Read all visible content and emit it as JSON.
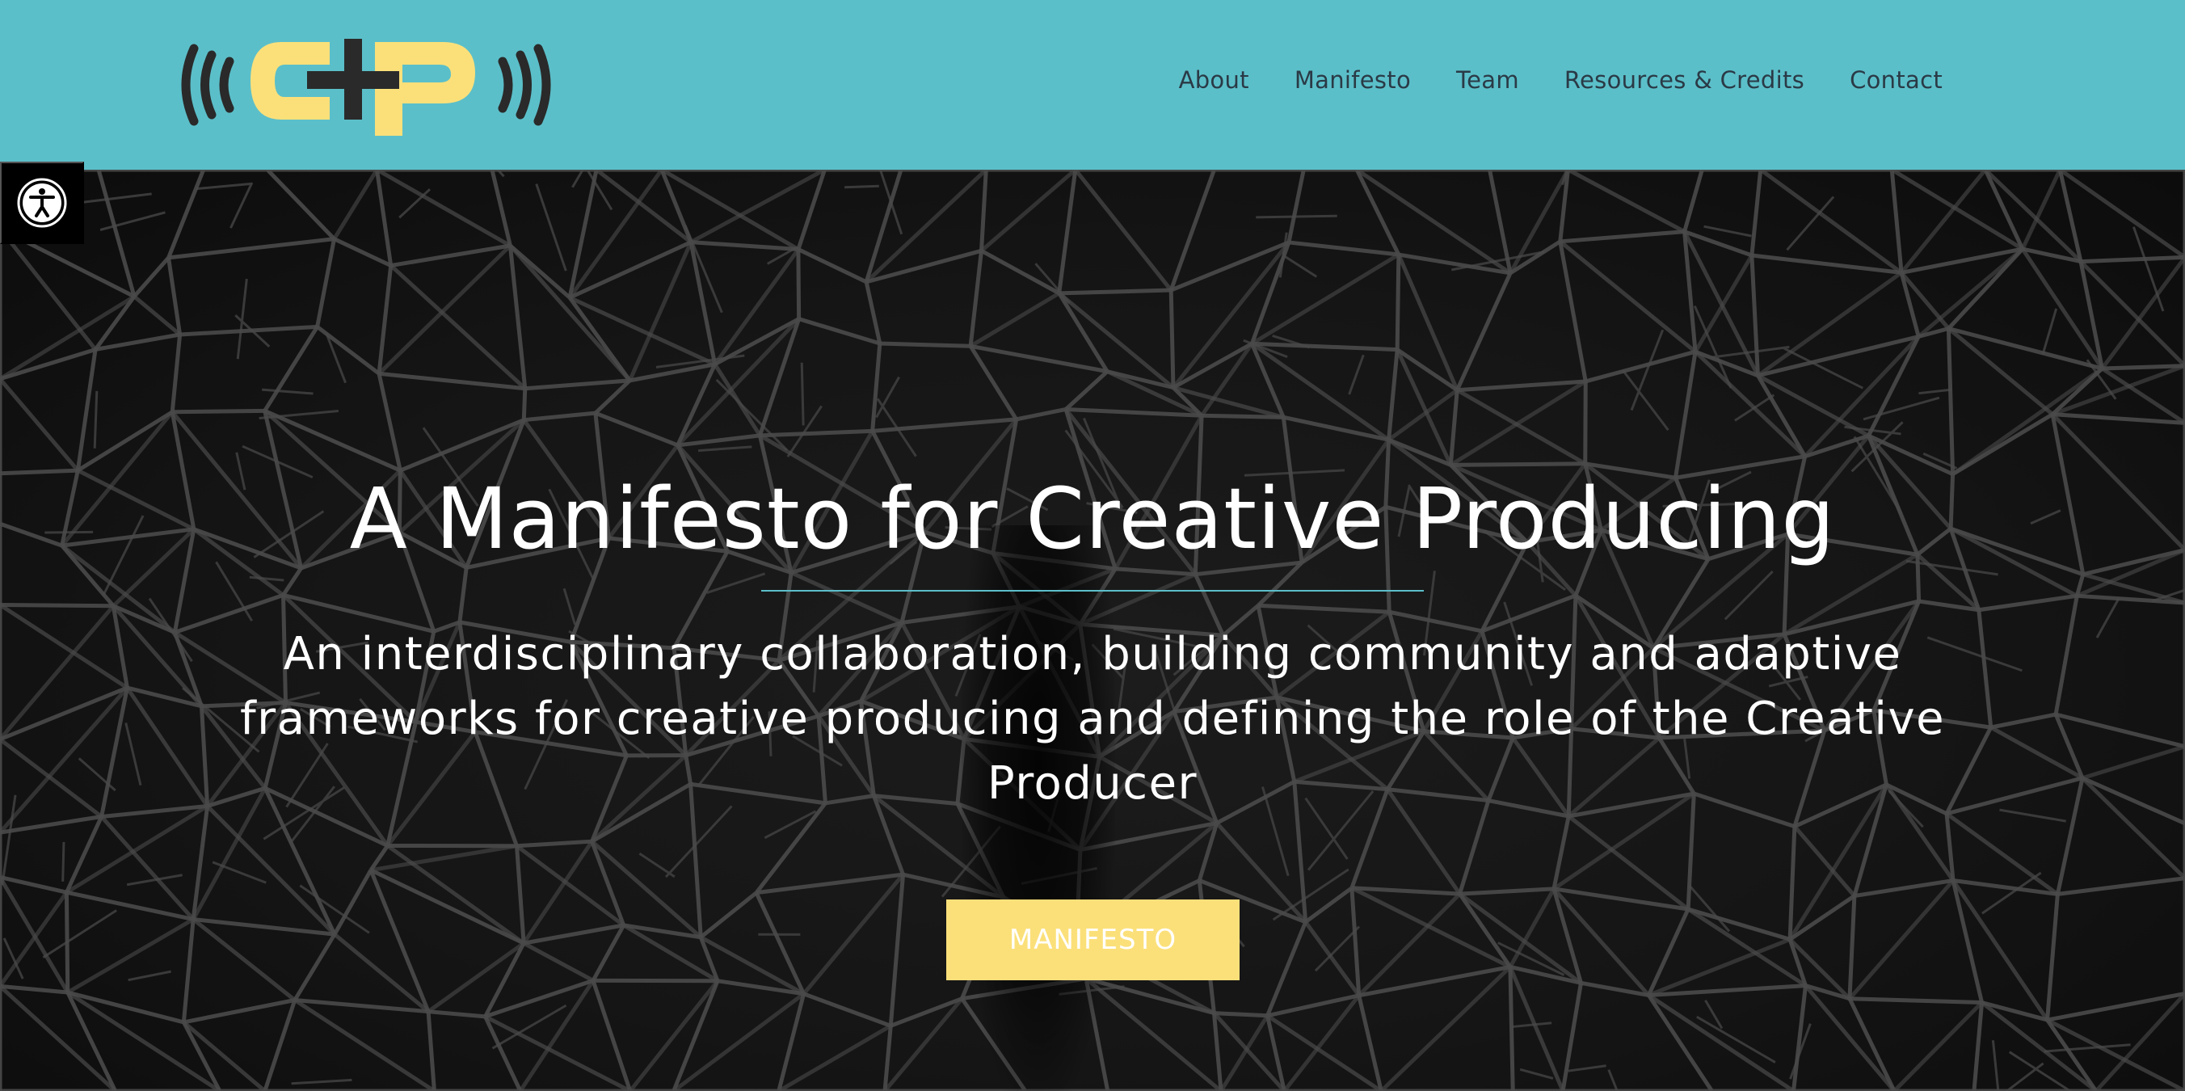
{
  "colors": {
    "header_bg": "#5bbfc9",
    "logo_yellow": "#fbe07a",
    "logo_dark": "#2a2a2a",
    "cta_bg": "#fbe07a",
    "divider": "#5bbfc9"
  },
  "header": {
    "logo_icon": "creative-producing-logo-icon",
    "nav": [
      {
        "label": "About"
      },
      {
        "label": "Manifesto"
      },
      {
        "label": "Team"
      },
      {
        "label": "Resources & Credits"
      },
      {
        "label": "Contact"
      }
    ]
  },
  "accessibility": {
    "icon": "accessibility-icon"
  },
  "hero": {
    "title": "A Manifesto for Creative Producing",
    "subtitle": "An interdisciplinary collaboration, building community and adaptive frameworks for creative producing and defining the role of the Creative Producer",
    "cta_label": "MANIFESTO"
  }
}
